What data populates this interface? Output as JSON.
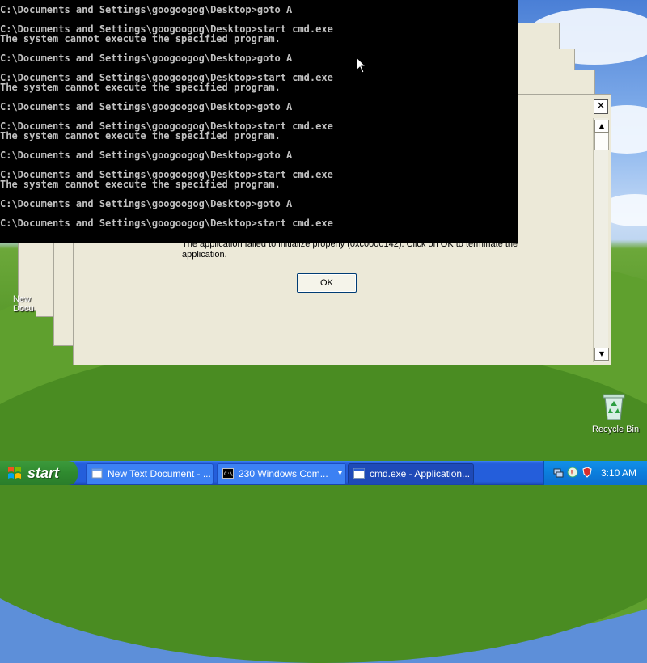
{
  "console": {
    "lines": [
      "C:\\Documents and Settings\\googoogog\\Desktop>goto A",
      "",
      "C:\\Documents and Settings\\googoogog\\Desktop>start cmd.exe",
      "The system cannot execute the specified program.",
      "",
      "C:\\Documents and Settings\\googoogog\\Desktop>goto A",
      "",
      "C:\\Documents and Settings\\googoogog\\Desktop>start cmd.exe",
      "The system cannot execute the specified program.",
      "",
      "C:\\Documents and Settings\\googoogog\\Desktop>goto A",
      "",
      "C:\\Documents and Settings\\googoogog\\Desktop>start cmd.exe",
      "The system cannot execute the specified program.",
      "",
      "C:\\Documents and Settings\\googoogog\\Desktop>goto A",
      "",
      "C:\\Documents and Settings\\googoogog\\Desktop>start cmd.exe",
      "The system cannot execute the specified program.",
      "",
      "C:\\Documents and Settings\\googoogog\\Desktop>goto A",
      "",
      "C:\\Documents and Settings\\googoogog\\Desktop>start cmd.exe"
    ]
  },
  "error_dialog": {
    "message": "The application failed to initialize properly (0xc0000142). Click on OK to terminate the application.",
    "ok_label": "OK",
    "close_glyph": "✕"
  },
  "desktop": {
    "new_doc_label_line1": "New",
    "new_doc_label_line2": "Docu",
    "recycle_bin_label": "Recycle Bin"
  },
  "taskbar": {
    "start_label": "start",
    "tasks": [
      {
        "label": "New Text Document - ..."
      },
      {
        "label": "230 Windows Com...",
        "count": "230",
        "arrow": "▾"
      },
      {
        "label": "cmd.exe - Application..."
      }
    ],
    "clock": "3:10 AM"
  },
  "colors": {
    "console_bg": "#000000",
    "console_fg": "#c0c0c0",
    "dialog_bg": "#ece9d8",
    "taskbar_blue": "#245edb",
    "start_green": "#2f8a2f",
    "tray_blue": "#0c7edc"
  }
}
